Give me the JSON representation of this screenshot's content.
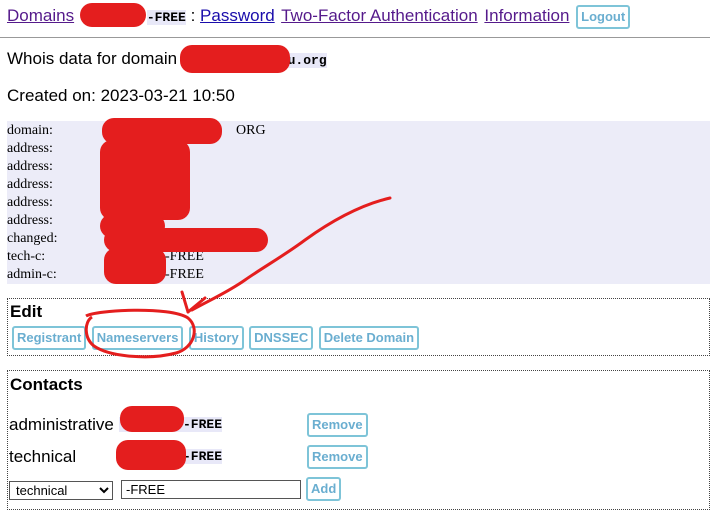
{
  "nav": {
    "domains": "Domains",
    "handle_suffix": "-FREE",
    "separator": ":",
    "password": "Password",
    "two_factor": "Two-Factor Authentication",
    "information": "Information",
    "logout": "Logout"
  },
  "whois": {
    "heading_prefix": "Whois data for domain",
    "domain_suffix": "eu.org",
    "created_label": "Created on:",
    "created_value": "2023-03-21 10:50"
  },
  "whois_record": [
    {
      "key": "domain:",
      "value": "ORG"
    },
    {
      "key": "address:",
      "value": ""
    },
    {
      "key": "address:",
      "value": ""
    },
    {
      "key": "address:",
      "value": ""
    },
    {
      "key": "address:",
      "value": ""
    },
    {
      "key": "address:",
      "value": ""
    },
    {
      "key": "changed:",
      "value": ""
    },
    {
      "key": "tech-c:",
      "value": "-FREE"
    },
    {
      "key": "admin-c:",
      "value": "-FREE"
    }
  ],
  "edit": {
    "title": "Edit",
    "buttons": [
      "Registrant",
      "Nameservers",
      "History",
      "DNSSEC",
      "Delete Domain"
    ]
  },
  "contacts": {
    "title": "Contacts",
    "rows": [
      {
        "role": "administrative",
        "handle": "-FREE",
        "action": "Remove"
      },
      {
        "role": "technical",
        "handle": "-FREE",
        "action": "Remove"
      }
    ],
    "new_role": "technical",
    "new_handle": "-FREE",
    "add_label": "Add"
  },
  "colors": {
    "link": "#551a8b",
    "button_border": "#7ec4d8",
    "highlight": "#ececf8",
    "annotation": "#e41e1e"
  }
}
